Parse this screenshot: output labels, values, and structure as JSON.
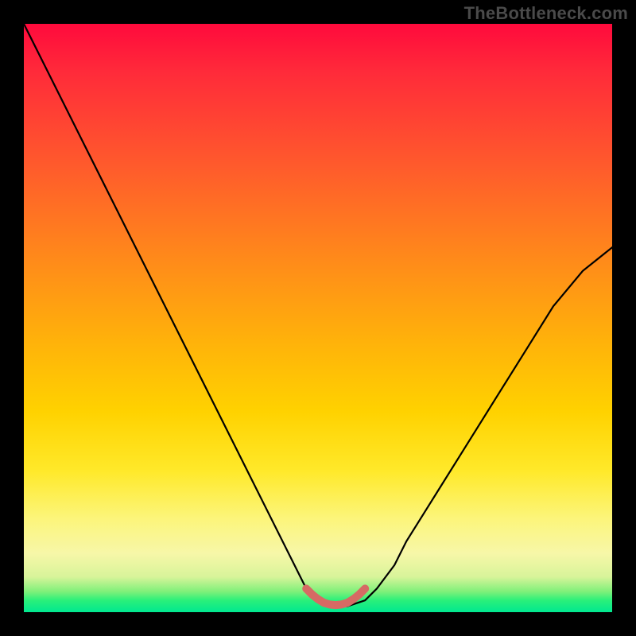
{
  "watermark": "TheBottleneck.com",
  "chart_data": {
    "type": "line",
    "title": "",
    "xlabel": "",
    "ylabel": "",
    "xlim": [
      0,
      100
    ],
    "ylim": [
      0,
      100
    ],
    "series": [
      {
        "name": "bottleneck-curve",
        "x": [
          0,
          5,
          10,
          15,
          20,
          25,
          30,
          35,
          40,
          45,
          48,
          50,
          52,
          55,
          58,
          60,
          63,
          65,
          70,
          75,
          80,
          85,
          90,
          95,
          100
        ],
        "values": [
          100,
          90,
          80,
          70,
          60,
          50,
          40,
          30,
          20,
          10,
          4,
          2,
          1,
          1,
          2,
          4,
          8,
          12,
          20,
          28,
          36,
          44,
          52,
          58,
          62
        ]
      },
      {
        "name": "highlight-segment",
        "x": [
          48,
          49,
          50,
          51,
          52,
          53,
          54,
          55,
          56,
          57,
          58
        ],
        "values": [
          4.0,
          3.0,
          2.2,
          1.6,
          1.3,
          1.2,
          1.3,
          1.6,
          2.2,
          3.0,
          4.0
        ]
      }
    ],
    "gradient_stops": [
      {
        "pos": 0,
        "color": "#ff0a3c"
      },
      {
        "pos": 0.4,
        "color": "#ff8a1a"
      },
      {
        "pos": 0.66,
        "color": "#ffd200"
      },
      {
        "pos": 0.9,
        "color": "#f7f7a8"
      },
      {
        "pos": 1.0,
        "color": "#00e890"
      }
    ],
    "highlight_color": "#d66a64",
    "curve_color": "#000000"
  }
}
